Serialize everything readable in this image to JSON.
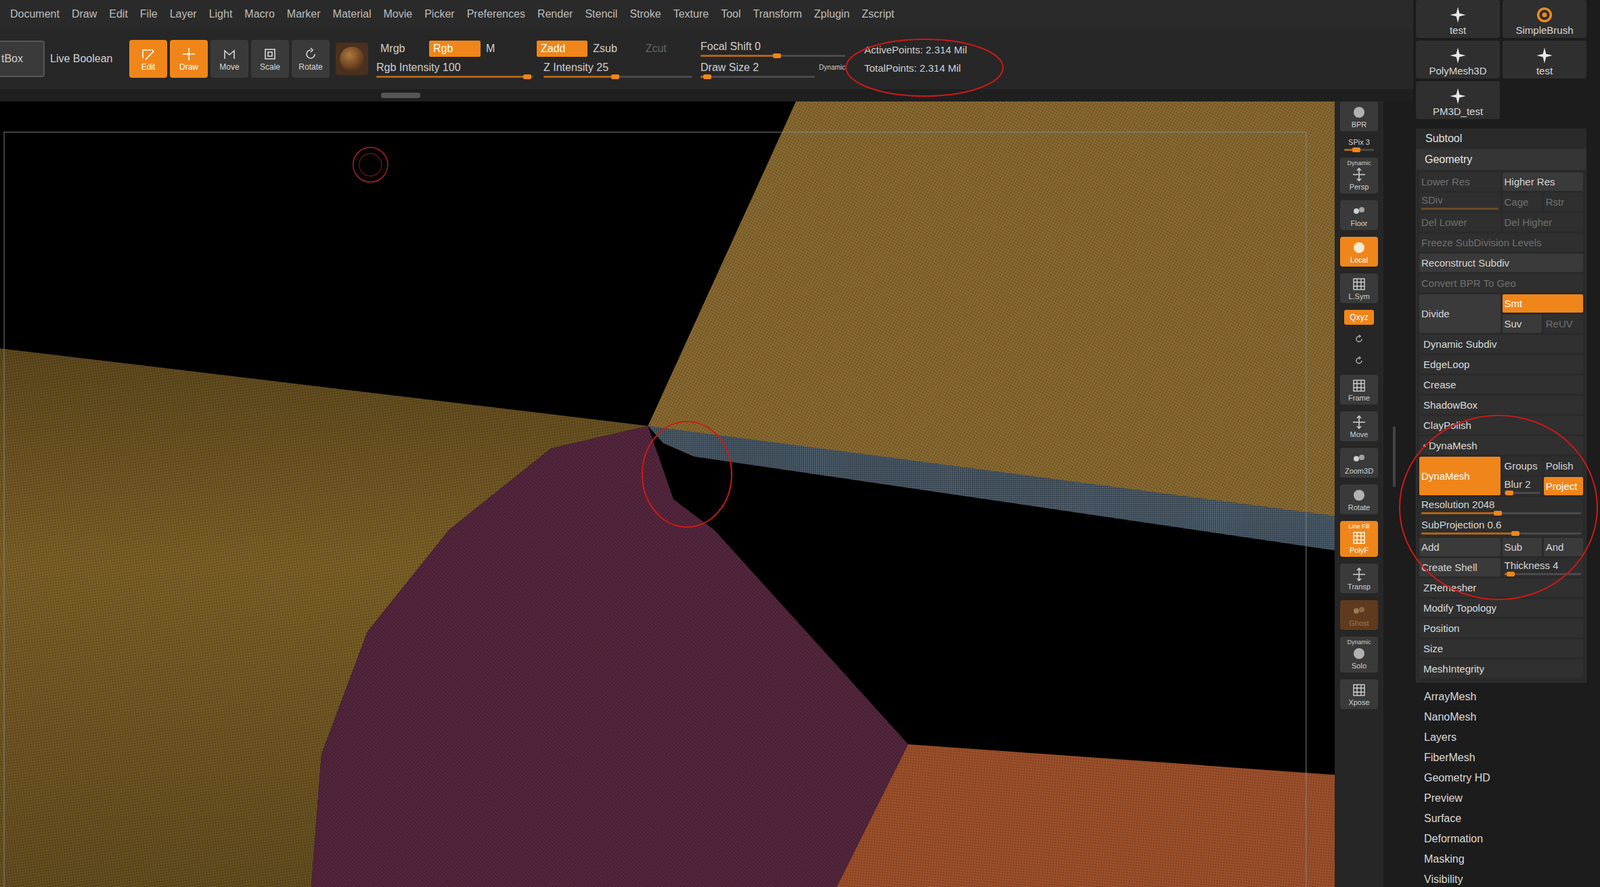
{
  "menu": [
    "Document",
    "Draw",
    "Edit",
    "File",
    "Layer",
    "Light",
    "Macro",
    "Marker",
    "Material",
    "Movie",
    "Picker",
    "Preferences",
    "Render",
    "Stencil",
    "Stroke",
    "Texture",
    "Tool",
    "Transform",
    "Zplugin",
    "Zscript"
  ],
  "toolbar": {
    "tool_button": "tBox",
    "live_boolean": {
      "label": "Live Boolean",
      "on": false
    },
    "modes": [
      {
        "label": "Edit",
        "selected": true
      },
      {
        "label": "Draw",
        "selected": true
      },
      {
        "label": "Move",
        "selected": false
      },
      {
        "label": "Scale",
        "selected": false
      },
      {
        "label": "Rotate",
        "selected": false
      }
    ],
    "color_modes": [
      {
        "label": "Mrgb",
        "selected": false
      },
      {
        "label": "Rgb",
        "selected": true
      },
      {
        "label": "M",
        "selected": false
      }
    ],
    "z_modes": [
      {
        "label": "Zadd",
        "selected": true,
        "disabled": false
      },
      {
        "label": "Zsub",
        "selected": false,
        "disabled": false
      },
      {
        "label": "Zcut",
        "selected": false,
        "disabled": true
      }
    ],
    "rgb_intensity": {
      "label": "Rgb Intensity",
      "value": "100",
      "level": 0.96
    },
    "z_intensity": {
      "label": "Z Intensity",
      "value": "25",
      "level": 0.48
    },
    "focal_shift": {
      "label": "Focal Shift",
      "value": "0",
      "level": 0.53
    },
    "draw_size": {
      "label": "Draw Size",
      "value": "2",
      "level": 0.06
    },
    "dynamic_label": "Dynamic",
    "stats": {
      "active": "ActivePoints: 2.314 Mil",
      "total": "TotalPoints: 2.314 Mil"
    }
  },
  "shelf": [
    {
      "kind": "button",
      "label": "BPR",
      "selected": false,
      "disabled": false
    },
    {
      "kind": "slider",
      "label": "SPix 3",
      "level": 0.4
    },
    {
      "kind": "button",
      "label": "Persp",
      "caption": "Dynamic",
      "selected": false,
      "disabled": false
    },
    {
      "kind": "button",
      "label": "Floor",
      "selected": false,
      "disabled": false
    },
    {
      "kind": "button",
      "label": "Local",
      "selected": true,
      "disabled": false
    },
    {
      "kind": "button",
      "label": "L.Sym",
      "selected": false,
      "disabled": false
    },
    {
      "kind": "small",
      "label": "Qxyz",
      "selected": true
    },
    {
      "kind": "mini"
    },
    {
      "kind": "mini"
    },
    {
      "kind": "button",
      "label": "Frame",
      "selected": false,
      "disabled": false
    },
    {
      "kind": "button",
      "label": "Move",
      "selected": false,
      "disabled": false
    },
    {
      "kind": "button",
      "label": "Zoom3D",
      "selected": false,
      "disabled": false
    },
    {
      "kind": "button",
      "label": "Rotate",
      "selected": false,
      "disabled": false
    },
    {
      "kind": "button",
      "label": "PolyF",
      "caption": "Line Fill",
      "selected": true,
      "disabled": false
    },
    {
      "kind": "button",
      "label": "Transp",
      "selected": false,
      "disabled": false
    },
    {
      "kind": "button",
      "label": "Ghost",
      "selected": false,
      "disabled": true
    },
    {
      "kind": "button",
      "label": "Solo",
      "caption": "Dynamic",
      "selected": false,
      "disabled": false
    },
    {
      "kind": "button",
      "label": "Xpose",
      "selected": false,
      "disabled": false
    }
  ],
  "brushes": [
    {
      "label": "test"
    },
    {
      "label": "SimpleBrush"
    },
    {
      "label": "PolyMesh3D"
    },
    {
      "label": "test"
    },
    {
      "label": "PM3D_test"
    }
  ],
  "subtool": "Subtool",
  "geometry": {
    "title": "Geometry",
    "lower_res": {
      "label": "Lower Res",
      "disabled": true
    },
    "higher_res": {
      "label": "Higher Res",
      "disabled": false
    },
    "sdiv": {
      "label": "SDiv",
      "level": 1,
      "disabled": true
    },
    "cage": {
      "label": "Cage",
      "disabled": true
    },
    "rstr": {
      "label": "Rstr",
      "disabled": true
    },
    "del_lower": {
      "label": "Del Lower",
      "disabled": true
    },
    "del_higher": {
      "label": "Del Higher",
      "disabled": true
    },
    "freeze": {
      "label": "Freeze SubDivision Levels",
      "disabled": true
    },
    "reconstruct": {
      "label": "Reconstruct Subdiv",
      "disabled": false
    },
    "convert": {
      "label": "Convert BPR To Geo",
      "disabled": true
    },
    "divide": {
      "label": "Divide"
    },
    "smt": {
      "label": "Smt",
      "selected": true
    },
    "suv": {
      "label": "Suv",
      "disabled": false
    },
    "reuv": {
      "label": "ReUV",
      "disabled": true
    },
    "subpalettes_before": [
      "Dynamic Subdiv",
      "EdgeLoop",
      "Crease",
      "ShadowBox",
      "ClayPolish"
    ],
    "dynamesh": {
      "title": "DynaMesh",
      "expanded": true,
      "button": {
        "label": "DynaMesh",
        "selected": true
      },
      "groups": {
        "label": "Groups",
        "selected": false
      },
      "polish": {
        "label": "Polish",
        "selected": false
      },
      "blur": {
        "label": "Blur",
        "value": "2",
        "level": 0.15
      },
      "project": {
        "label": "Project",
        "selected": true
      },
      "resolution": {
        "label": "Resolution",
        "value": "2048",
        "level": 0.48
      },
      "subprojection": {
        "label": "SubProjection",
        "value": "0.6",
        "level": 0.59
      },
      "add": {
        "label": "Add"
      },
      "sub": {
        "label": "Sub"
      },
      "and": {
        "label": "And"
      },
      "create_shell": {
        "label": "Create Shell"
      },
      "thickness": {
        "label": "Thickness",
        "value": "4",
        "level": 0.08
      }
    },
    "subpalettes_after": [
      "ZRemesher",
      "Modify Topology",
      "Position",
      "Size",
      "MeshIntegrity"
    ]
  },
  "palettes": [
    "ArrayMesh",
    "NanoMesh",
    "Layers",
    "FiberMesh",
    "Geometry HD",
    "Preview",
    "Surface",
    "Deformation",
    "Masking",
    "Visibility"
  ]
}
